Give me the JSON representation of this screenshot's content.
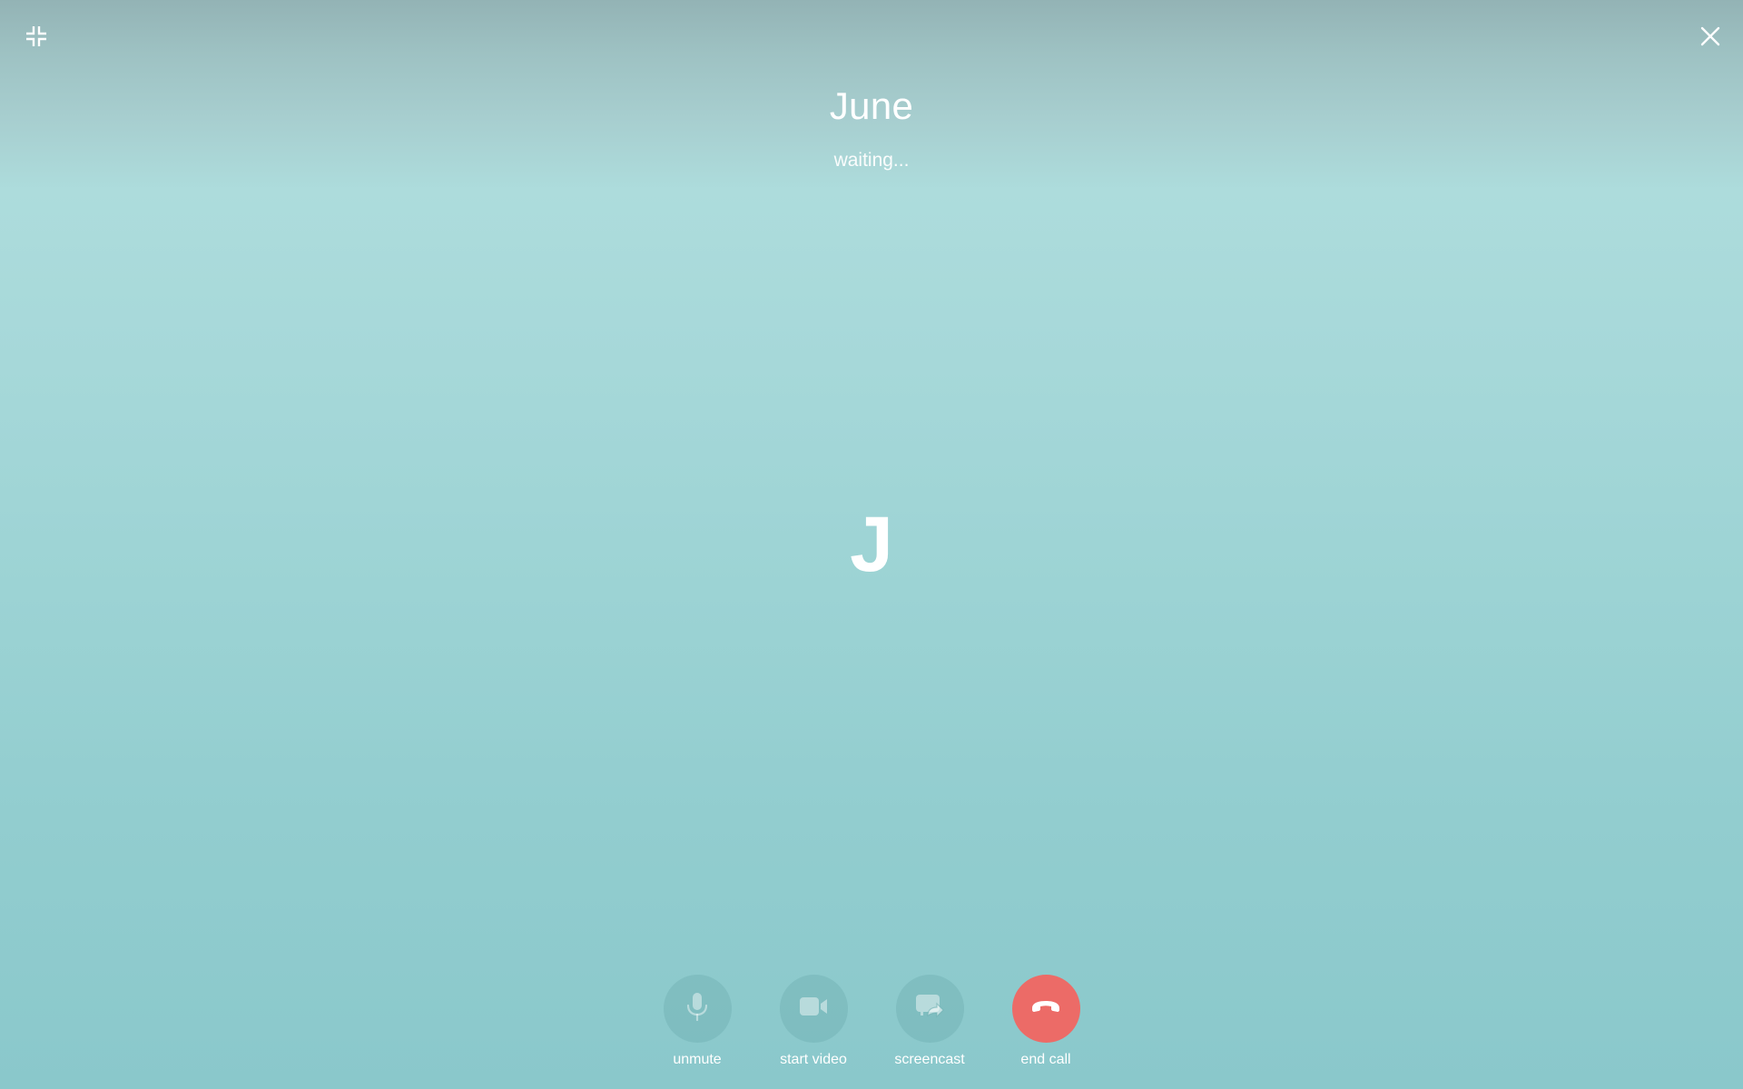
{
  "window": {
    "minimize_icon": "collapse-fullscreen-icon",
    "close_icon": "close-icon"
  },
  "peer": {
    "name": "June",
    "status": "waiting...",
    "initial": "J"
  },
  "controls": [
    {
      "label": "unmute",
      "icon": "microphone-icon"
    },
    {
      "label": "start video",
      "icon": "video-camera-icon"
    },
    {
      "label": "screencast",
      "icon": "screencast-icon"
    },
    {
      "label": "end call",
      "icon": "hang-up-icon"
    }
  ],
  "colors": {
    "end_call": "#ec6b67",
    "background_top": "#93b3b5",
    "background_bottom": "#8ac8cb"
  }
}
